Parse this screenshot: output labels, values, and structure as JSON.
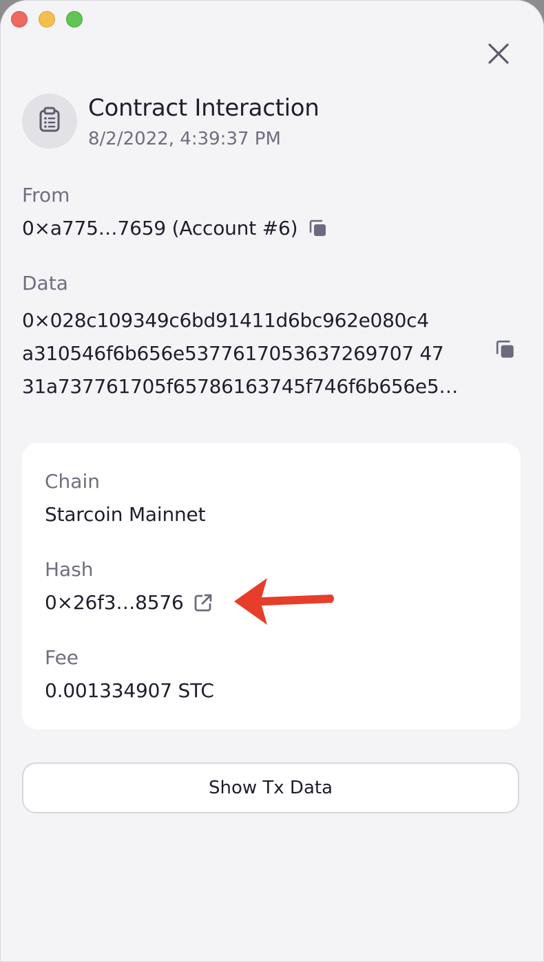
{
  "window": {
    "traffic_lights": [
      "close",
      "minimize",
      "zoom"
    ]
  },
  "header": {
    "icon": "clipboard-list-icon",
    "title": "Contract Interaction",
    "timestamp": "8/2/2022, 4:39:37 PM"
  },
  "close_icon": "close-icon",
  "from": {
    "label": "From",
    "value": "0×a775…7659 (Account #6)",
    "copy_icon": "copy-icon"
  },
  "data": {
    "label": "Data",
    "lines": [
      "0×028c109349c6bd91411d6bc962e080c4",
      "a310546f6b656e5377617053637269707 47",
      "31a737761705f65786163745f746f6b656e5…"
    ],
    "copy_icon": "copy-icon"
  },
  "details": {
    "chain": {
      "label": "Chain",
      "value": "Starcoin Mainnet"
    },
    "hash": {
      "label": "Hash",
      "value": "0×26f3…8576",
      "link_icon": "external-link-icon"
    },
    "fee": {
      "label": "Fee",
      "value": "0.001334907 STC"
    }
  },
  "annotation": {
    "arrow_color": "#e63e2a"
  },
  "actions": {
    "show_tx_data": "Show Tx Data"
  }
}
